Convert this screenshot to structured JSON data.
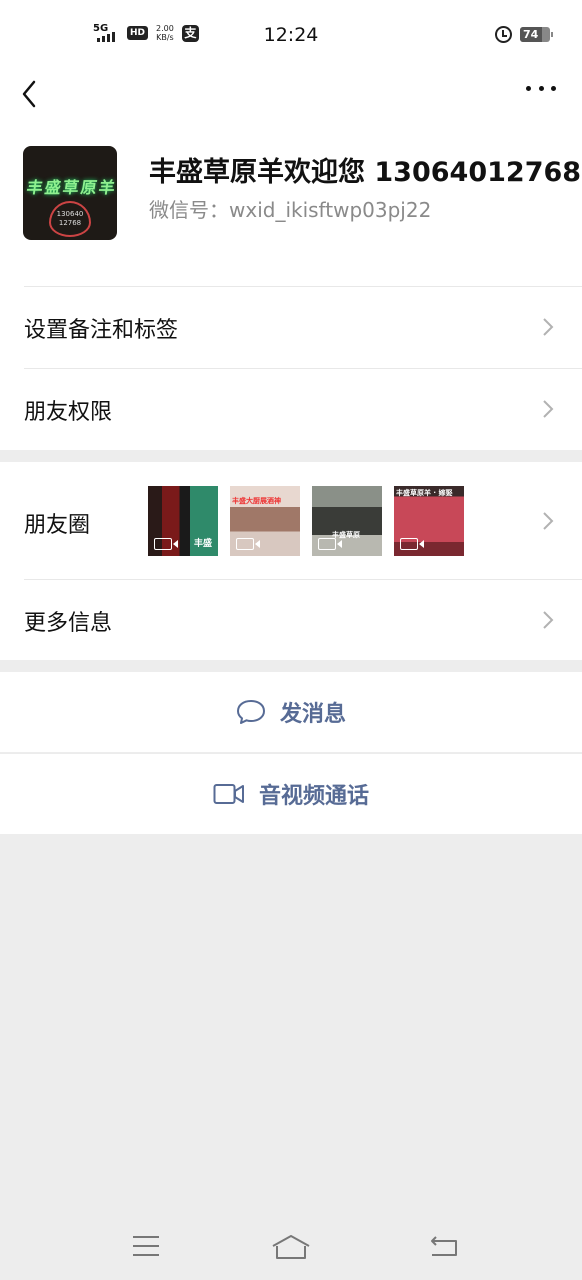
{
  "status_bar": {
    "network": "5G",
    "hd": "HD",
    "speed_value": "2.00",
    "speed_unit": "KB/s",
    "pay_glyph": "支",
    "time": "12:24",
    "battery": "74"
  },
  "profile": {
    "name": "丰盛草原羊欢迎您 13064012768",
    "wxid": "微信号：wxid_ikisftwp03pj22",
    "avatar_sign": "丰盛草原羊",
    "avatar_number": "130640 12768"
  },
  "menu": {
    "remark_tags": "设置备注和标签",
    "friend_permissions": "朋友权限",
    "moments": "朋友圈",
    "more_info": "更多信息"
  },
  "moments_thumbs": [
    {
      "caption": "丰盛",
      "has_video": true,
      "color": "#3a7d6a"
    },
    {
      "caption": "丰盛大厨展酒神",
      "has_video": true,
      "color": "#b89a8c"
    },
    {
      "caption": "丰盛草原",
      "has_video": true,
      "color": "#5a6058"
    },
    {
      "caption": "丰盛草原羊 · 嫁娶",
      "has_video": true,
      "color": "#9a3040"
    }
  ],
  "actions": {
    "send_message": "发消息",
    "video_call": "音视频通话"
  },
  "colors": {
    "link_blue": "#576b95",
    "background": "#ededed",
    "card": "#ffffff"
  }
}
